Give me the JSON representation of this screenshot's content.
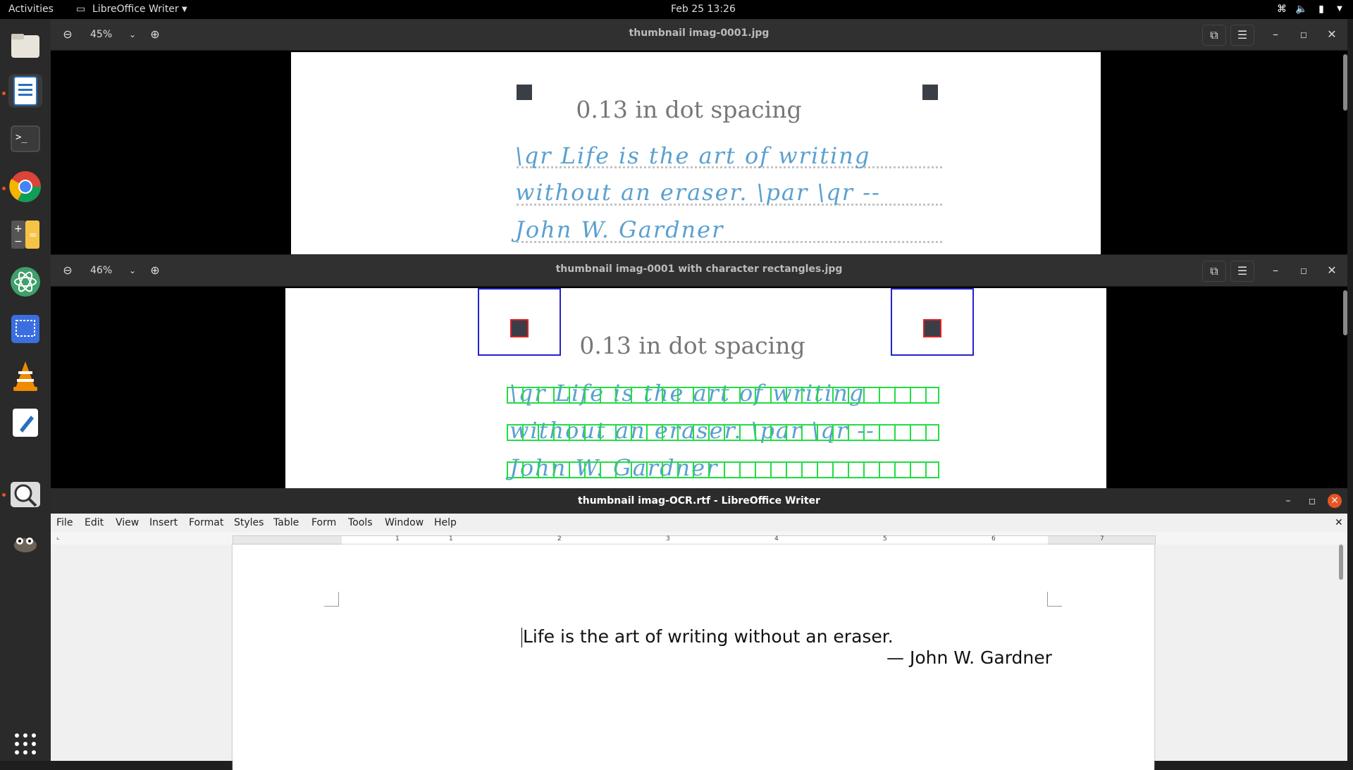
{
  "topbar": {
    "activities": "Activities",
    "app_menu": "LibreOffice Writer",
    "clock": "Feb 25  13:26"
  },
  "dock": {
    "items": [
      "files-icon",
      "writer-icon",
      "terminal-icon",
      "chrome-icon",
      "calculator-icon",
      "atom-icon",
      "screenshot-icon",
      "vlc-icon",
      "text-editor-icon",
      "magnifier-icon",
      "gimp-icon"
    ],
    "apps_grid": "show-apps-icon"
  },
  "viewer1": {
    "zoom": "45%",
    "title": "thumbnail imag-0001.jpg",
    "heading": "0.13 in dot spacing",
    "lines": [
      "\\qr Life is the art of writing",
      "without an eraser. \\par \\qr --",
      "John W. Gardner"
    ]
  },
  "viewer2": {
    "zoom": "46%",
    "title": "thumbnail imag-0001 with character rectangles.jpg",
    "heading": "0.13 in dot spacing",
    "lines": [
      "\\qr Life is the art of writing",
      "without an eraser. \\par \\qr --",
      "John W. Gardner"
    ]
  },
  "writer": {
    "title": "thumbnail imag-OCR.rtf - LibreOffice Writer",
    "menu": [
      "File",
      "Edit",
      "View",
      "Insert",
      "Format",
      "Styles",
      "Table",
      "Form",
      "Tools",
      "Window",
      "Help"
    ],
    "ruler_numbers": [
      "1",
      "1",
      "2",
      "3",
      "4",
      "5",
      "6",
      "7"
    ],
    "line1": "Life is the art of writing without an eraser.",
    "line2": "— John W. Gardner"
  },
  "colors": {
    "accent": "#e95420",
    "handwriting": "#5aa0d0",
    "box_blue": "#2222cc",
    "box_red": "#dd2222",
    "box_green": "#22dd44"
  }
}
